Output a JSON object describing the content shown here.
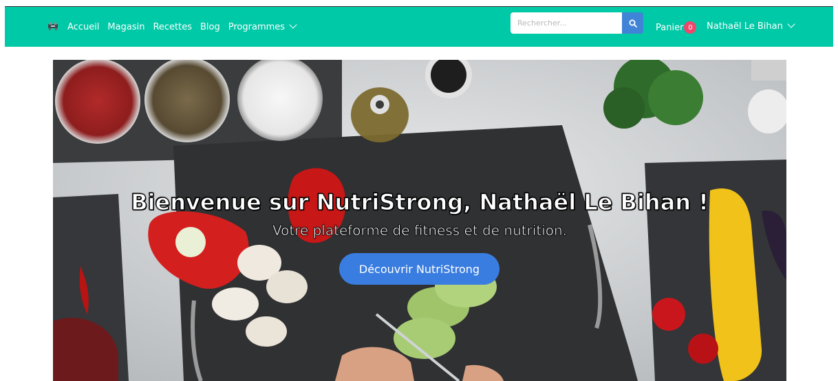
{
  "nav": {
    "brand_icon": "nutristrong-logo-icon",
    "links": [
      {
        "label": "Accueil"
      },
      {
        "label": "Magasin"
      },
      {
        "label": "Recettes"
      },
      {
        "label": "Blog"
      },
      {
        "label": "Programmes"
      }
    ],
    "search": {
      "placeholder": "Rechercher...",
      "value": "",
      "icon": "search-icon"
    },
    "cart": {
      "label": "Panier",
      "count": "0"
    },
    "user": {
      "name": "Nathaël Le Bihan"
    }
  },
  "hero": {
    "title": "Bienvenue sur NutriStrong, Nathaël Le Bihan !",
    "subtitle": "Votre plateforme de fitness et de nutrition.",
    "cta_label": "Découvrir NutriStrong"
  },
  "colors": {
    "navbar_bg": "#00c9a7",
    "search_button": "#3f84d6",
    "badge": "#f0466b",
    "cta": "#3a7de0"
  }
}
